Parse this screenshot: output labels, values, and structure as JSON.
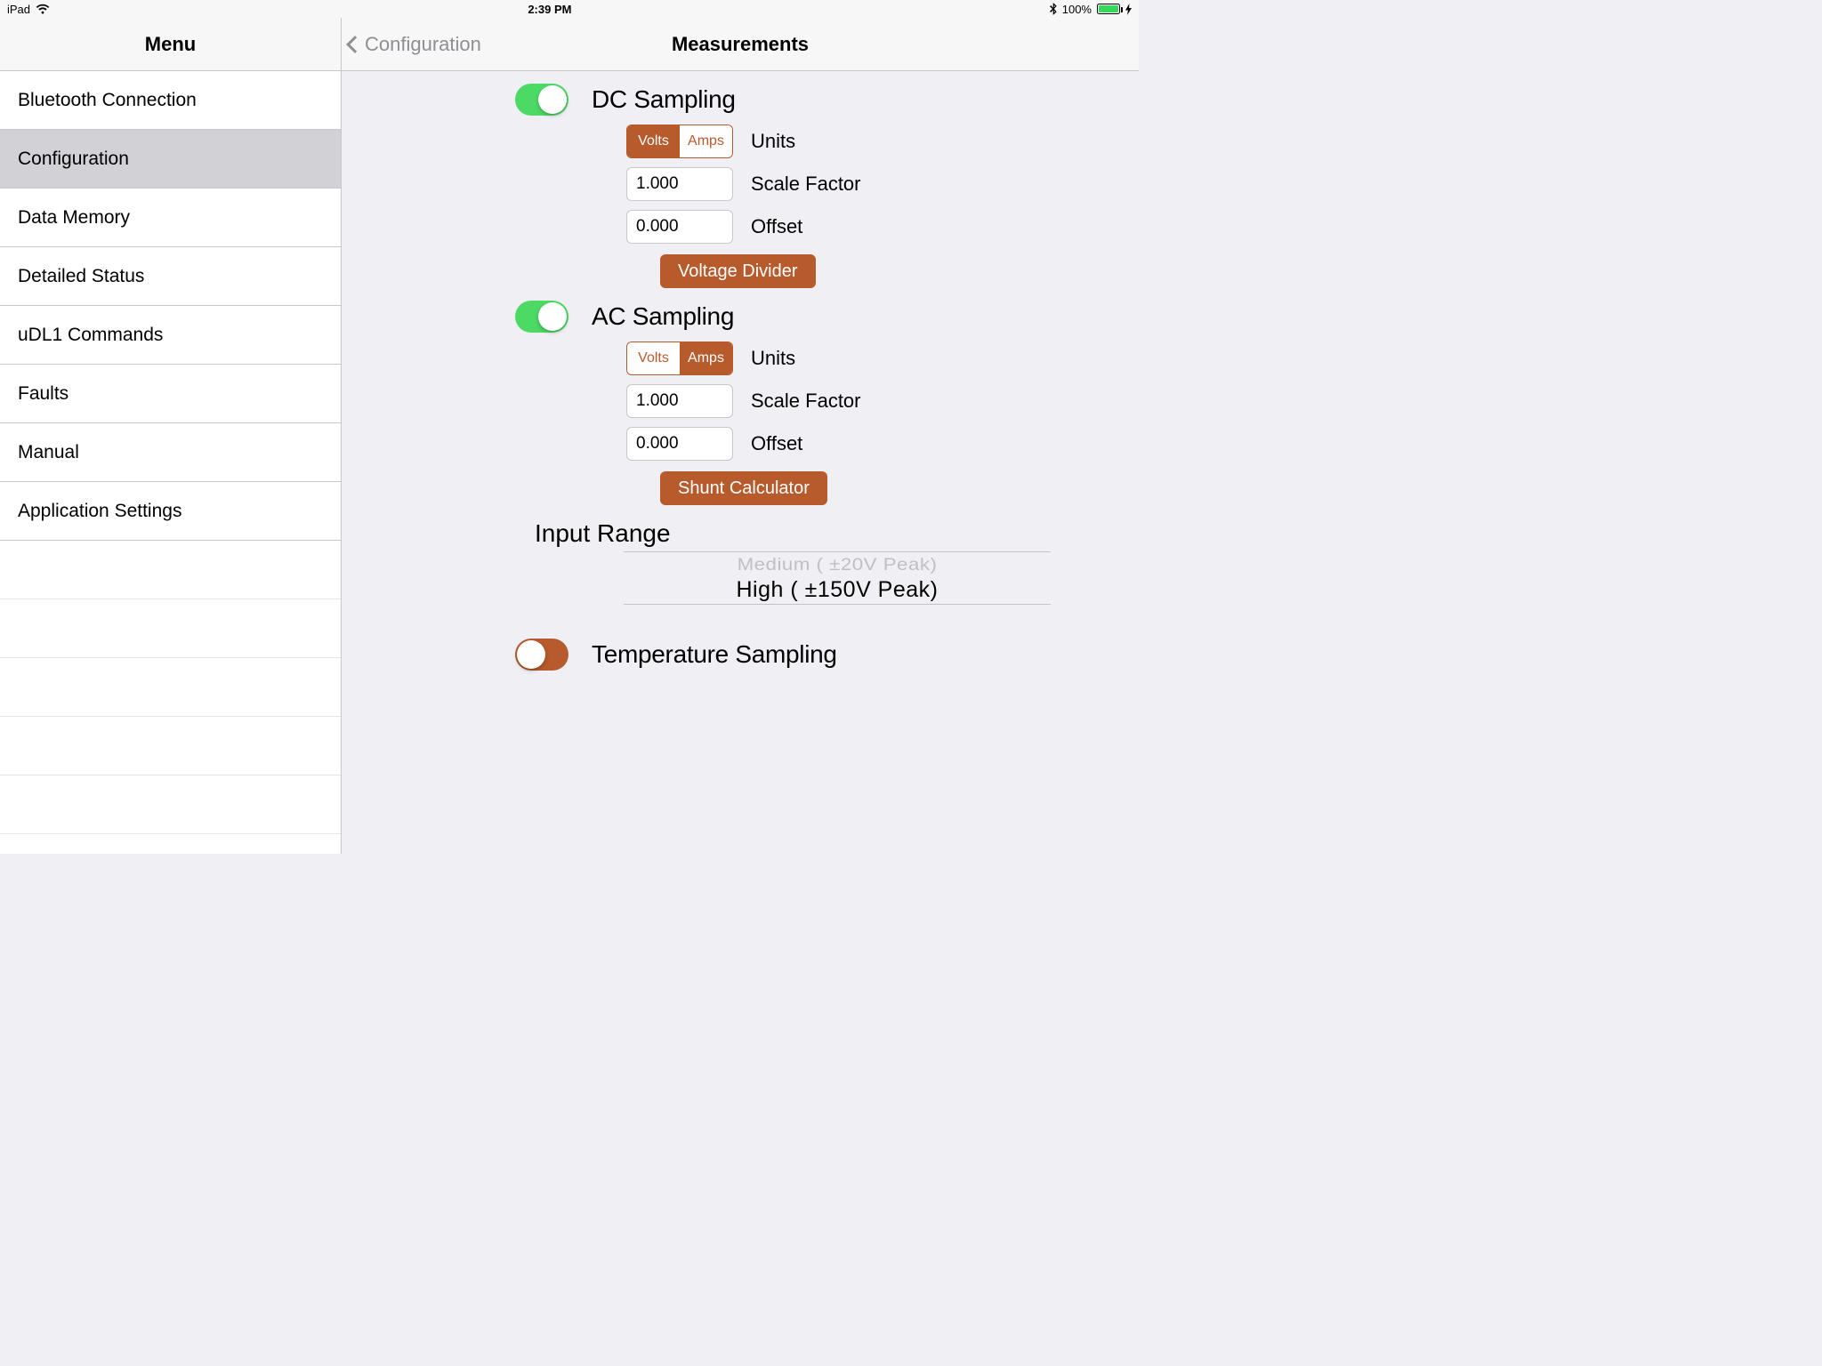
{
  "status": {
    "device": "iPad",
    "time": "2:39 PM",
    "battery_pct": "100%"
  },
  "sidebar": {
    "title": "Menu",
    "items": [
      "Bluetooth Connection",
      "Configuration",
      "Data Memory",
      "Detailed Status",
      "uDL1 Commands",
      "Faults",
      "Manual",
      "Application Settings"
    ],
    "selected_index": 1
  },
  "detail": {
    "back_label": "Configuration",
    "title": "Measurements"
  },
  "dc": {
    "title": "DC Sampling",
    "enabled": true,
    "units": {
      "opt_a": "Volts",
      "opt_b": "Amps",
      "selected": "Volts",
      "label": "Units"
    },
    "scale_factor": {
      "value": "1.000",
      "label": "Scale Factor"
    },
    "offset": {
      "value": "0.000",
      "label": "Offset"
    },
    "button": "Voltage Divider"
  },
  "ac": {
    "title": "AC Sampling",
    "enabled": true,
    "units": {
      "opt_a": "Volts",
      "opt_b": "Amps",
      "selected": "Amps",
      "label": "Units"
    },
    "scale_factor": {
      "value": "1.000",
      "label": "Scale Factor"
    },
    "offset": {
      "value": "0.000",
      "label": "Offset"
    },
    "button": "Shunt Calculator"
  },
  "input_range": {
    "label": "Input Range",
    "prev": "Medium  (  ±20V Peak)",
    "selected": "High   ( ±150V Peak)"
  },
  "temperature": {
    "title": "Temperature Sampling",
    "enabled": false
  }
}
